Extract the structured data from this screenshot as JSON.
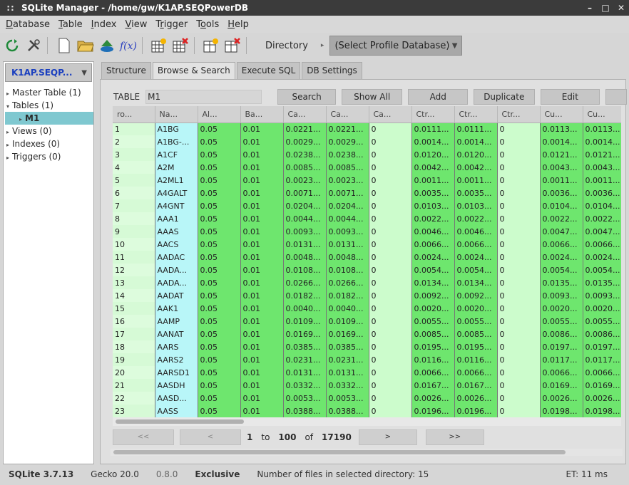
{
  "window": {
    "title": "SQLite Manager - /home/gw/K1AP.SEQPowerDB",
    "grip": "::",
    "min_label": "–",
    "max_label": "□",
    "close_label": "✕"
  },
  "menu": [
    {
      "pre": "",
      "u": "D",
      "post": "atabase"
    },
    {
      "pre": "",
      "u": "T",
      "post": "able"
    },
    {
      "pre": "",
      "u": "I",
      "post": "ndex"
    },
    {
      "pre": "",
      "u": "V",
      "post": "iew"
    },
    {
      "pre": "T",
      "u": "r",
      "post": "igger"
    },
    {
      "pre": "T",
      "u": "o",
      "post": "ols"
    },
    {
      "pre": "",
      "u": "H",
      "post": "elp"
    }
  ],
  "toolbar": {
    "directory_label": "Directory",
    "arrow": "▸",
    "profile_placeholder": "(Select Profile Database)",
    "chevron": "▼"
  },
  "sidebar": {
    "db_name": "K1AP.SEQP...",
    "chevron": "▼",
    "tree": [
      {
        "toggle": "▸",
        "label": "Master Table (1)"
      },
      {
        "toggle": "▾",
        "label": "Tables (1)"
      },
      {
        "toggle": "▸",
        "label": "M1",
        "selected": true
      },
      {
        "toggle": "▸",
        "label": "Views (0)"
      },
      {
        "toggle": "▸",
        "label": "Indexes (0)"
      },
      {
        "toggle": "▸",
        "label": "Triggers (0)"
      }
    ]
  },
  "tabs": [
    "Structure",
    "Browse & Search",
    "Execute SQL",
    "DB Settings"
  ],
  "browse": {
    "table_label": "TABLE",
    "table_name": "M1",
    "buttons": {
      "search": "Search",
      "show_all": "Show All",
      "add": "Add",
      "duplicate": "Duplicate",
      "edit": "Edit"
    },
    "columns": [
      "ro...",
      "Na...",
      "Al...",
      "Ba...",
      "Ca...",
      "Ca...",
      "Ca...",
      "Ctr...",
      "Ctr...",
      "Ctr...",
      "Cu...",
      "Cu..."
    ],
    "rows": [
      [
        "1",
        "A1BG",
        "0.05",
        "0.01",
        "0.0221...",
        "0.0221...",
        "0",
        "0.0111...",
        "0.0111...",
        "0",
        "0.0113...",
        "0.0113..."
      ],
      [
        "2",
        "A1BG-...",
        "0.05",
        "0.01",
        "0.0029...",
        "0.0029...",
        "0",
        "0.0014...",
        "0.0014...",
        "0",
        "0.0014...",
        "0.0014..."
      ],
      [
        "3",
        "A1CF",
        "0.05",
        "0.01",
        "0.0238...",
        "0.0238...",
        "0",
        "0.0120...",
        "0.0120...",
        "0",
        "0.0121...",
        "0.0121..."
      ],
      [
        "4",
        "A2M",
        "0.05",
        "0.01",
        "0.0085...",
        "0.0085...",
        "0",
        "0.0042...",
        "0.0042...",
        "0",
        "0.0043...",
        "0.0043..."
      ],
      [
        "5",
        "A2ML1",
        "0.05",
        "0.01",
        "0.0023...",
        "0.0023...",
        "0",
        "0.0011...",
        "0.0011...",
        "0",
        "0.0011...",
        "0.0011..."
      ],
      [
        "6",
        "A4GALT",
        "0.05",
        "0.01",
        "0.0071...",
        "0.0071...",
        "0",
        "0.0035...",
        "0.0035...",
        "0",
        "0.0036...",
        "0.0036..."
      ],
      [
        "7",
        "A4GNT",
        "0.05",
        "0.01",
        "0.0204...",
        "0.0204...",
        "0",
        "0.0103...",
        "0.0103...",
        "0",
        "0.0104...",
        "0.0104..."
      ],
      [
        "8",
        "AAA1",
        "0.05",
        "0.01",
        "0.0044...",
        "0.0044...",
        "0",
        "0.0022...",
        "0.0022...",
        "0",
        "0.0022...",
        "0.0022..."
      ],
      [
        "9",
        "AAAS",
        "0.05",
        "0.01",
        "0.0093...",
        "0.0093...",
        "0",
        "0.0046...",
        "0.0046...",
        "0",
        "0.0047...",
        "0.0047..."
      ],
      [
        "10",
        "AACS",
        "0.05",
        "0.01",
        "0.0131...",
        "0.0131...",
        "0",
        "0.0066...",
        "0.0066...",
        "0",
        "0.0066...",
        "0.0066..."
      ],
      [
        "11",
        "AADAC",
        "0.05",
        "0.01",
        "0.0048...",
        "0.0048...",
        "0",
        "0.0024...",
        "0.0024...",
        "0",
        "0.0024...",
        "0.0024..."
      ],
      [
        "12",
        "AADA...",
        "0.05",
        "0.01",
        "0.0108...",
        "0.0108...",
        "0",
        "0.0054...",
        "0.0054...",
        "0",
        "0.0054...",
        "0.0054..."
      ],
      [
        "13",
        "AADA...",
        "0.05",
        "0.01",
        "0.0266...",
        "0.0266...",
        "0",
        "0.0134...",
        "0.0134...",
        "0",
        "0.0135...",
        "0.0135..."
      ],
      [
        "14",
        "AADAT",
        "0.05",
        "0.01",
        "0.0182...",
        "0.0182...",
        "0",
        "0.0092...",
        "0.0092...",
        "0",
        "0.0093...",
        "0.0093..."
      ],
      [
        "15",
        "AAK1",
        "0.05",
        "0.01",
        "0.0040...",
        "0.0040...",
        "0",
        "0.0020...",
        "0.0020...",
        "0",
        "0.0020...",
        "0.0020..."
      ],
      [
        "16",
        "AAMP",
        "0.05",
        "0.01",
        "0.0109...",
        "0.0109...",
        "0",
        "0.0055...",
        "0.0055...",
        "0",
        "0.0055...",
        "0.0055..."
      ],
      [
        "17",
        "AANAT",
        "0.05",
        "0.01",
        "0.0169...",
        "0.0169...",
        "0",
        "0.0085...",
        "0.0085...",
        "0",
        "0.0086...",
        "0.0086..."
      ],
      [
        "18",
        "AARS",
        "0.05",
        "0.01",
        "0.0385...",
        "0.0385...",
        "0",
        "0.0195...",
        "0.0195...",
        "0",
        "0.0197...",
        "0.0197..."
      ],
      [
        "19",
        "AARS2",
        "0.05",
        "0.01",
        "0.0231...",
        "0.0231...",
        "0",
        "0.0116...",
        "0.0116...",
        "0",
        "0.0117...",
        "0.0117..."
      ],
      [
        "20",
        "AARSD1",
        "0.05",
        "0.01",
        "0.0131...",
        "0.0131...",
        "0",
        "0.0066...",
        "0.0066...",
        "0",
        "0.0066...",
        "0.0066..."
      ],
      [
        "21",
        "AASDH",
        "0.05",
        "0.01",
        "0.0332...",
        "0.0332...",
        "0",
        "0.0167...",
        "0.0167...",
        "0",
        "0.0169...",
        "0.0169..."
      ],
      [
        "22",
        "AASD...",
        "0.05",
        "0.01",
        "0.0053...",
        "0.0053...",
        "0",
        "0.0026...",
        "0.0026...",
        "0",
        "0.0026...",
        "0.0026..."
      ],
      [
        "23",
        "AASS",
        "0.05",
        "0.01",
        "0.0388...",
        "0.0388...",
        "0",
        "0.0196...",
        "0.0196...",
        "0",
        "0.0198...",
        "0.0198..."
      ]
    ],
    "pager": {
      "first": "<<",
      "prev": "<",
      "from": "1",
      "to_label": "to",
      "to": "100",
      "of_label": "of",
      "total": "17190",
      "next": ">",
      "last": ">>"
    }
  },
  "status": {
    "sqlite": "SQLite 3.7.13",
    "gecko": "Gecko 20.0",
    "version": "0.8.0",
    "mode": "Exclusive",
    "message": "Number of files in selected directory: 15",
    "et": "ET: 11 ms"
  },
  "colors": {
    "cell_green": "#6ee66e",
    "name_cyan": "#b8f6f8",
    "selection": "#7fc8d0"
  }
}
